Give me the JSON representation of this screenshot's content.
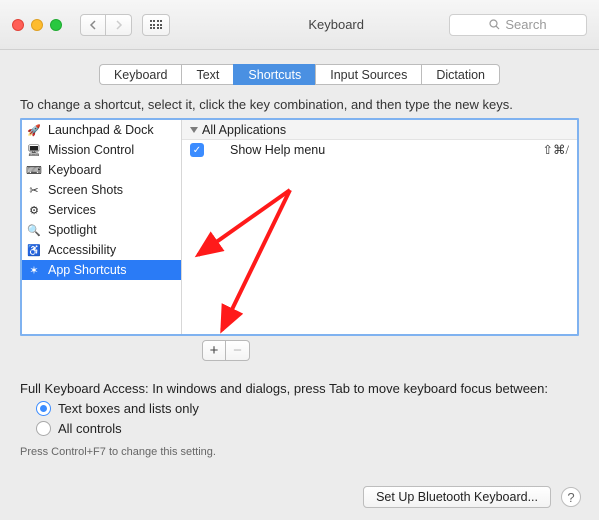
{
  "window": {
    "title": "Keyboard"
  },
  "search": {
    "placeholder": "Search"
  },
  "tabs": [
    {
      "label": "Keyboard"
    },
    {
      "label": "Text"
    },
    {
      "label": "Shortcuts",
      "selected": true
    },
    {
      "label": "Input Sources"
    },
    {
      "label": "Dictation"
    }
  ],
  "instruction": "To change a shortcut, select it, click the key combination, and then type the new keys.",
  "categories": [
    {
      "icon": "launchpad-icon",
      "label": "Launchpad & Dock"
    },
    {
      "icon": "mission-control-icon",
      "label": "Mission Control"
    },
    {
      "icon": "keyboard-icon",
      "label": "Keyboard"
    },
    {
      "icon": "screenshots-icon",
      "label": "Screen Shots"
    },
    {
      "icon": "services-icon",
      "label": "Services"
    },
    {
      "icon": "spotlight-icon",
      "label": "Spotlight"
    },
    {
      "icon": "accessibility-icon",
      "label": "Accessibility"
    },
    {
      "icon": "app-shortcuts-icon",
      "label": "App Shortcuts",
      "selected": true
    }
  ],
  "group_header": "All Applications",
  "shortcuts": [
    {
      "checked": true,
      "label": "Show Help menu",
      "keys": "⇧⌘/"
    }
  ],
  "fka": {
    "label": "Full Keyboard Access: In windows and dialogs, press Tab to move keyboard focus between:",
    "opt1": "Text boxes and lists only",
    "opt2": "All controls",
    "note": "Press Control+F7 to change this setting."
  },
  "footer": {
    "button": "Set Up Bluetooth Keyboard..."
  }
}
